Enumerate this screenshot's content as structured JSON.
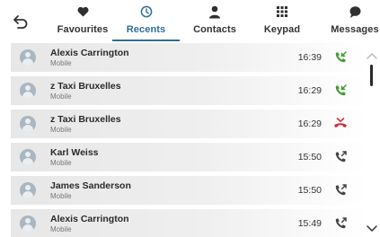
{
  "tabs": [
    {
      "label": "Favourites",
      "icon": "heart-icon"
    },
    {
      "label": "Recents",
      "icon": "clock-icon"
    },
    {
      "label": "Contacts",
      "icon": "person-icon"
    },
    {
      "label": "Keypad",
      "icon": "keypad-icon"
    },
    {
      "label": "Messages",
      "icon": "message-icon"
    }
  ],
  "active_tab": "Recents",
  "colors": {
    "accent": "#2f6e99",
    "incoming": "#3f9b2c",
    "missed": "#d6283a",
    "outgoing": "#444444"
  },
  "recents": [
    {
      "name": "Alexis Carrington",
      "type": "Mobile",
      "time": "16:39",
      "call": "incoming"
    },
    {
      "name": "z Taxi Bruxelles",
      "type": "Mobile",
      "time": "16:29",
      "call": "incoming"
    },
    {
      "name": "z Taxi Bruxelles",
      "type": "Mobile",
      "time": "16:29",
      "call": "missed"
    },
    {
      "name": "Karl Weiss",
      "type": "Mobile",
      "time": "15:50",
      "call": "outgoing"
    },
    {
      "name": "James Sanderson",
      "type": "Mobile",
      "time": "15:50",
      "call": "outgoing"
    },
    {
      "name": "Alexis Carrington",
      "type": "Mobile",
      "time": "15:49",
      "call": "outgoing"
    }
  ]
}
